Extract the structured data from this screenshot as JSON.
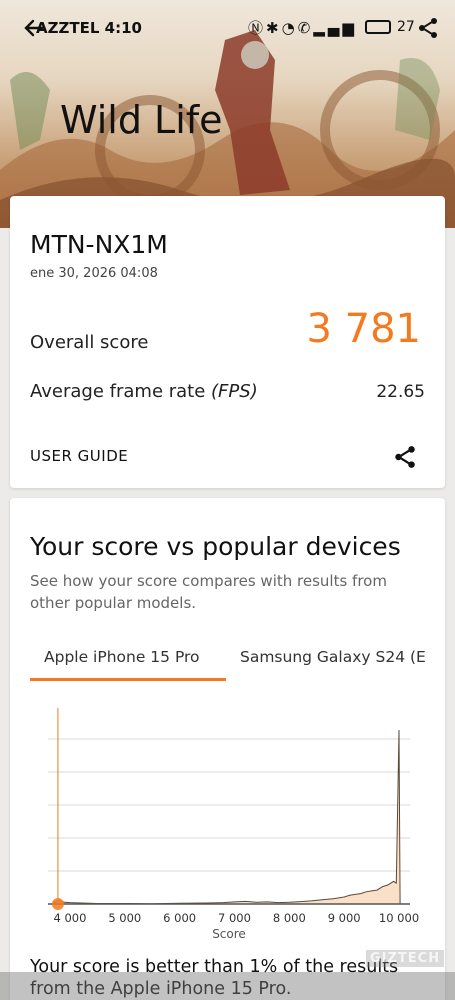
{
  "status_bar": {
    "carrier": "AZZTEL",
    "time": "4:10",
    "battery": "27"
  },
  "hero": {
    "title": "Wild Life"
  },
  "score_card": {
    "device_name": "MTN-NX1M",
    "date": "ene 30, 2026 04:08",
    "overall_label": "Overall score",
    "overall_value": "3 781",
    "fps_label_prefix": "Average frame rate ",
    "fps_label_unit": "(FPS)",
    "fps_value": "22.65",
    "user_guide_label": "USER GUIDE"
  },
  "comparison": {
    "title": "Your score vs popular devices",
    "description": "See how your score compares with results from other popular models.",
    "tabs": [
      {
        "label": "Apple iPhone 15 Pro",
        "active": true
      },
      {
        "label": "Samsung Galaxy S24 (E"
      }
    ],
    "result_text": "Your score is better than 1% of the results from the Apple iPhone 15 Pro."
  },
  "chart_data": {
    "type": "area",
    "xlabel": "Score",
    "ylabel": "",
    "xlim": [
      3600,
      10200
    ],
    "ylim": [
      0,
      1
    ],
    "x_ticks": [
      "4 000",
      "5 000",
      "6 000",
      "7 000",
      "8 000",
      "9 000",
      "10 000"
    ],
    "x_tick_values": [
      4000,
      5000,
      6000,
      7000,
      8000,
      9000,
      10000
    ],
    "grid": true,
    "marker_score": 3781,
    "series": [
      {
        "x": [
          3700,
          3800,
          3900,
          4000,
          4500,
          5000,
          5500,
          6000,
          6500,
          6800,
          7000,
          7200,
          7400,
          7600,
          7800,
          8000,
          8200,
          8400,
          8600,
          8800,
          9000,
          9100,
          9200,
          9300,
          9400,
          9500,
          9600,
          9700,
          9800,
          9900,
          9950,
          10000,
          10020
        ],
        "y": [
          0.005,
          0.02,
          0.01,
          0.008,
          0.003,
          0.003,
          0.002,
          0.004,
          0.006,
          0.008,
          0.012,
          0.015,
          0.01,
          0.012,
          0.008,
          0.01,
          0.014,
          0.018,
          0.025,
          0.03,
          0.04,
          0.05,
          0.055,
          0.06,
          0.07,
          0.075,
          0.08,
          0.1,
          0.11,
          0.13,
          0.12,
          1.0,
          0.0
        ],
        "color": "#fbe0c8"
      }
    ],
    "colors": {
      "accent": "#f47a20",
      "fill": "#fbe0c8",
      "stroke": "#5a4a38"
    }
  },
  "watermark": "GIZTECH"
}
